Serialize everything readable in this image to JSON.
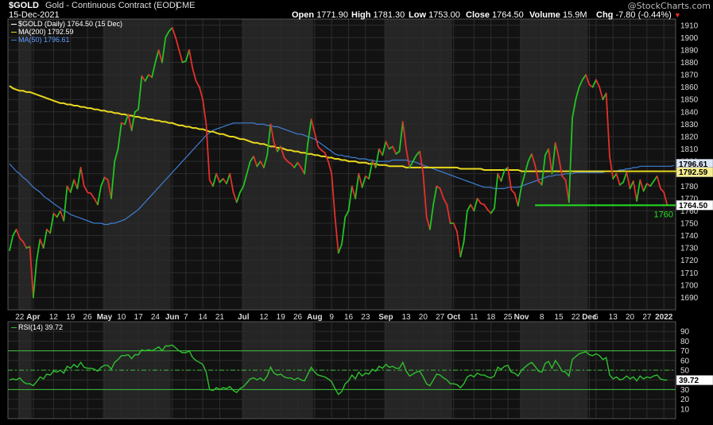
{
  "header": {
    "symbol": "$GOLD",
    "description": "Gold - Continuous Contract (EOD)",
    "exchange": "CME",
    "date": "15-Dec-2021",
    "watermark": "@StockCharts.com",
    "open_label": "Open",
    "open": "1771.90",
    "high_label": "High",
    "high": "1781.30",
    "low_label": "Low",
    "low": "1753.00",
    "close_label": "Close",
    "close": "1764.50",
    "volume_label": "Volume",
    "volume": "15.9M",
    "chg_label": "Chg",
    "chg": "-7.80 (-0.44%)"
  },
  "legend": {
    "price": "$GOLD (Daily) 1764.50 (15 Dec)",
    "ma200": "MA(200) 1792.59",
    "ma50": "MA(50) 1796.61",
    "rsi": "RSI(14) 39.72"
  },
  "colors": {
    "up": "#22c322",
    "down": "#e5302a",
    "ma200": "#e8d81e",
    "ma50": "#3f7fd6",
    "rsi": "#2ec02e",
    "band_dark": "#121212",
    "band_light": "#252525",
    "level": "#22e022"
  },
  "chart_data": [
    {
      "type": "line",
      "title": "$GOLD Gold - Continuous Contract (EOD)",
      "ylim": [
        1680,
        1915
      ],
      "y_ticks": [
        1690,
        1700,
        1710,
        1720,
        1730,
        1740,
        1750,
        1760,
        1770,
        1780,
        1790,
        1800,
        1810,
        1820,
        1830,
        1840,
        1850,
        1860,
        1870,
        1880,
        1890,
        1900,
        1910
      ],
      "x_ticks": [
        {
          "label": "22",
          "i": 3
        },
        {
          "label": "Apr",
          "i": 7
        },
        {
          "label": "12",
          "i": 13
        },
        {
          "label": "19",
          "i": 18
        },
        {
          "label": "26",
          "i": 23
        },
        {
          "label": "May",
          "i": 28
        },
        {
          "label": "10",
          "i": 33
        },
        {
          "label": "17",
          "i": 38
        },
        {
          "label": "24",
          "i": 43
        },
        {
          "label": "Jun",
          "i": 48
        },
        {
          "label": "7",
          "i": 52
        },
        {
          "label": "14",
          "i": 57
        },
        {
          "label": "21",
          "i": 62
        },
        {
          "label": "Jul",
          "i": 69
        },
        {
          "label": "12",
          "i": 75
        },
        {
          "label": "19",
          "i": 80
        },
        {
          "label": "26",
          "i": 85
        },
        {
          "label": "Aug",
          "i": 90
        },
        {
          "label": "9",
          "i": 95
        },
        {
          "label": "16",
          "i": 100
        },
        {
          "label": "23",
          "i": 105
        },
        {
          "label": "Sep",
          "i": 111
        },
        {
          "label": "13",
          "i": 117
        },
        {
          "label": "20",
          "i": 122
        },
        {
          "label": "27",
          "i": 127
        },
        {
          "label": "Oct",
          "i": 131
        },
        {
          "label": "11",
          "i": 137
        },
        {
          "label": "18",
          "i": 142
        },
        {
          "label": "25",
          "i": 147
        },
        {
          "label": "Nov",
          "i": 151
        },
        {
          "label": "8",
          "i": 157
        },
        {
          "label": "15",
          "i": 162
        },
        {
          "label": "22",
          "i": 167
        },
        {
          "label": "Dec",
          "i": 171
        },
        {
          "label": "6",
          "i": 173
        },
        {
          "label": "13",
          "i": 178
        },
        {
          "label": "20",
          "i": 183
        },
        {
          "label": "27",
          "i": 188
        },
        {
          "label": "2022",
          "i": 193
        }
      ],
      "months_shaded": [
        [
          3,
          7
        ],
        [
          28,
          48
        ],
        [
          69,
          90
        ],
        [
          111,
          131
        ],
        [
          151,
          171
        ]
      ],
      "n": 197,
      "series": [
        {
          "name": "$GOLD (Daily)",
          "values": [
            1728,
            1740,
            1745,
            1738,
            1735,
            1730,
            1731,
            1690,
            1720,
            1737,
            1730,
            1745,
            1742,
            1758,
            1755,
            1760,
            1752,
            1780,
            1775,
            1785,
            1778,
            1795,
            1780,
            1775,
            1774,
            1770,
            1765,
            1780,
            1787,
            1785,
            1770,
            1800,
            1810,
            1831,
            1830,
            1838,
            1825,
            1840,
            1842,
            1869,
            1865,
            1870,
            1868,
            1880,
            1890,
            1880,
            1900,
            1905,
            1908,
            1900,
            1890,
            1880,
            1881,
            1890,
            1875,
            1865,
            1860,
            1850,
            1830,
            1785,
            1780,
            1790,
            1783,
            1786,
            1782,
            1790,
            1775,
            1767,
            1775,
            1780,
            1790,
            1800,
            1804,
            1796,
            1800,
            1795,
            1805,
            1830,
            1815,
            1808,
            1812,
            1803,
            1800,
            1798,
            1795,
            1799,
            1795,
            1790,
            1815,
            1834,
            1823,
            1812,
            1809,
            1807,
            1800,
            1790,
            1755,
            1726,
            1733,
            1755,
            1760,
            1780,
            1770,
            1790,
            1779,
            1788,
            1786,
            1800,
            1795,
            1810,
            1805,
            1816,
            1810,
            1812,
            1806,
            1808,
            1832,
            1810,
            1795,
            1800,
            1805,
            1808,
            1790,
            1755,
            1745,
            1765,
            1780,
            1778,
            1770,
            1765,
            1750,
            1750,
            1743,
            1723,
            1735,
            1760,
            1765,
            1760,
            1770,
            1766,
            1765,
            1761,
            1758,
            1762,
            1790,
            1784,
            1793,
            1795,
            1777,
            1774,
            1764,
            1780,
            1790,
            1800,
            1806,
            1797,
            1784,
            1781,
            1805,
            1810,
            1790,
            1815,
            1803,
            1788,
            1785,
            1767,
            1835,
            1850,
            1860,
            1866,
            1870,
            1862,
            1860,
            1866,
            1860,
            1850,
            1855,
            1804,
            1786,
            1790,
            1781,
            1783,
            1791,
            1778,
            1784,
            1768,
            1785,
            1776,
            1782,
            1780,
            1784,
            1788,
            1778,
            1775,
            1764.5
          ]
        },
        {
          "name": "MA(200)",
          "values": [
            1861,
            1859,
            1858,
            1857,
            1857,
            1856,
            1856,
            1855,
            1854,
            1853,
            1852,
            1851,
            1850,
            1849,
            1848,
            1847,
            1847,
            1846,
            1846,
            1845,
            1845,
            1844,
            1844,
            1843,
            1843,
            1842,
            1842,
            1841,
            1841,
            1840,
            1840,
            1839,
            1839,
            1838,
            1838,
            1837,
            1837,
            1836,
            1836,
            1835,
            1835,
            1834,
            1834,
            1833,
            1833,
            1832,
            1832,
            1831,
            1831,
            1830,
            1829,
            1829,
            1828,
            1828,
            1827,
            1827,
            1826,
            1826,
            1825,
            1824,
            1824,
            1823,
            1822,
            1822,
            1821,
            1820,
            1820,
            1819,
            1818,
            1818,
            1817,
            1816,
            1815,
            1815,
            1814,
            1814,
            1813,
            1812,
            1812,
            1811,
            1811,
            1810,
            1809,
            1809,
            1808,
            1808,
            1807,
            1807,
            1806,
            1806,
            1805,
            1805,
            1804,
            1804,
            1803,
            1803,
            1802,
            1802,
            1801,
            1801,
            1800,
            1800,
            1800,
            1799,
            1799,
            1799,
            1798,
            1798,
            1798,
            1797,
            1797,
            1797,
            1796,
            1796,
            1796,
            1796,
            1796,
            1795,
            1795,
            1795,
            1795,
            1795,
            1795,
            1795,
            1795,
            1795,
            1795,
            1795,
            1795,
            1795,
            1795,
            1795,
            1795,
            1794,
            1794,
            1794,
            1794,
            1794,
            1794,
            1794,
            1793,
            1793,
            1793,
            1793,
            1793,
            1793,
            1793,
            1793,
            1793,
            1793,
            1793,
            1792,
            1792,
            1792,
            1792,
            1792,
            1792,
            1792,
            1792,
            1792,
            1792,
            1792,
            1792,
            1792,
            1792,
            1792,
            1792,
            1792,
            1792,
            1792,
            1792,
            1792,
            1792,
            1792,
            1792,
            1792,
            1792,
            1792,
            1792,
            1792,
            1792,
            1792,
            1792,
            1792,
            1792,
            1792,
            1792,
            1792,
            1792,
            1792,
            1792,
            1792,
            1792,
            1792,
            1792,
            1792,
            1792,
            1792,
            1792.59
          ]
        },
        {
          "name": "MA(50)",
          "values": [
            1798,
            1795,
            1792,
            1790,
            1787,
            1785,
            1782,
            1779,
            1777,
            1775,
            1772,
            1770,
            1768,
            1766,
            1764,
            1762,
            1760,
            1759,
            1757,
            1756,
            1755,
            1754,
            1753,
            1752,
            1751,
            1750,
            1750,
            1750,
            1749,
            1749,
            1750,
            1750,
            1751,
            1752,
            1753,
            1755,
            1757,
            1759,
            1761,
            1764,
            1767,
            1770,
            1773,
            1776,
            1779,
            1782,
            1785,
            1788,
            1791,
            1794,
            1797,
            1800,
            1803,
            1806,
            1809,
            1812,
            1815,
            1818,
            1821,
            1823,
            1825,
            1826,
            1827,
            1828,
            1829,
            1830,
            1831,
            1831,
            1831,
            1831,
            1831,
            1831,
            1831,
            1830,
            1830,
            1830,
            1829,
            1829,
            1828,
            1828,
            1827,
            1826,
            1825,
            1824,
            1823,
            1822,
            1822,
            1821,
            1820,
            1819,
            1818,
            1816,
            1814,
            1812,
            1810,
            1808,
            1806,
            1805,
            1805,
            1804,
            1804,
            1803,
            1803,
            1802,
            1802,
            1802,
            1801,
            1801,
            1800,
            1800,
            1800,
            1800,
            1800,
            1801,
            1801,
            1801,
            1801,
            1801,
            1800,
            1800,
            1799,
            1798,
            1797,
            1796,
            1795,
            1794,
            1793,
            1792,
            1791,
            1790,
            1789,
            1788,
            1787,
            1786,
            1785,
            1784,
            1783,
            1782,
            1781,
            1780,
            1779,
            1779,
            1779,
            1778,
            1778,
            1778,
            1778,
            1779,
            1779,
            1779,
            1779,
            1780,
            1781,
            1782,
            1783,
            1784,
            1785,
            1786,
            1787,
            1788,
            1788,
            1789,
            1789,
            1789,
            1790,
            1790,
            1790,
            1791,
            1791,
            1791,
            1791,
            1791,
            1791,
            1791,
            1791,
            1791,
            1792,
            1792,
            1792,
            1792,
            1793,
            1793,
            1794,
            1794,
            1795,
            1795,
            1796,
            1796,
            1796,
            1796,
            1796,
            1796,
            1796,
            1796,
            1796,
            1796,
            1796.61
          ]
        }
      ],
      "last_close_label": "1764.50",
      "ma200_label": "1792.59",
      "ma50_label": "1796.61",
      "level_line": {
        "value": 1764.5,
        "label": "1760",
        "start_i": 155
      }
    },
    {
      "type": "line",
      "title": "RSI(14) 39.72",
      "ylim": [
        0,
        100
      ],
      "y_ticks": [
        10,
        20,
        30,
        40,
        50,
        60,
        70,
        80,
        90
      ],
      "ref_lines": [
        30,
        50,
        70
      ],
      "last_label": "39.72",
      "series": [
        {
          "name": "RSI(14)",
          "values": [
            40,
            41,
            40,
            42,
            38,
            36,
            36,
            34,
            38,
            43,
            41,
            46,
            45,
            49,
            48,
            50,
            47,
            54,
            52,
            56,
            53,
            58,
            53,
            52,
            52,
            51,
            49,
            53,
            55,
            55,
            51,
            58,
            61,
            65,
            65,
            66,
            62,
            66,
            66,
            71,
            70,
            71,
            70,
            72,
            74,
            70,
            75,
            75,
            76,
            73,
            70,
            68,
            68,
            70,
            63,
            60,
            58,
            56,
            48,
            30,
            29,
            32,
            30,
            32,
            31,
            33,
            29,
            27,
            31,
            33,
            37,
            41,
            42,
            40,
            42,
            39,
            44,
            53,
            47,
            45,
            46,
            43,
            42,
            42,
            40,
            42,
            40,
            39,
            46,
            53,
            48,
            45,
            44,
            43,
            41,
            38,
            31,
            25,
            28,
            36,
            39,
            45,
            41,
            48,
            44,
            47,
            46,
            51,
            49,
            54,
            52,
            56,
            53,
            54,
            52,
            52,
            58,
            49,
            44,
            46,
            48,
            49,
            43,
            36,
            34,
            40,
            46,
            45,
            42,
            40,
            36,
            36,
            35,
            32,
            36,
            43,
            45,
            43,
            47,
            45,
            45,
            43,
            42,
            44,
            53,
            51,
            54,
            55,
            48,
            47,
            44,
            50,
            53,
            56,
            58,
            54,
            49,
            48,
            57,
            59,
            52,
            60,
            55,
            49,
            48,
            44,
            61,
            64,
            67,
            68,
            69,
            66,
            65,
            67,
            65,
            61,
            63,
            45,
            41,
            43,
            40,
            41,
            44,
            41,
            43,
            39,
            44,
            41,
            43,
            42,
            44,
            45,
            41,
            40,
            39.72
          ]
        }
      ]
    }
  ]
}
